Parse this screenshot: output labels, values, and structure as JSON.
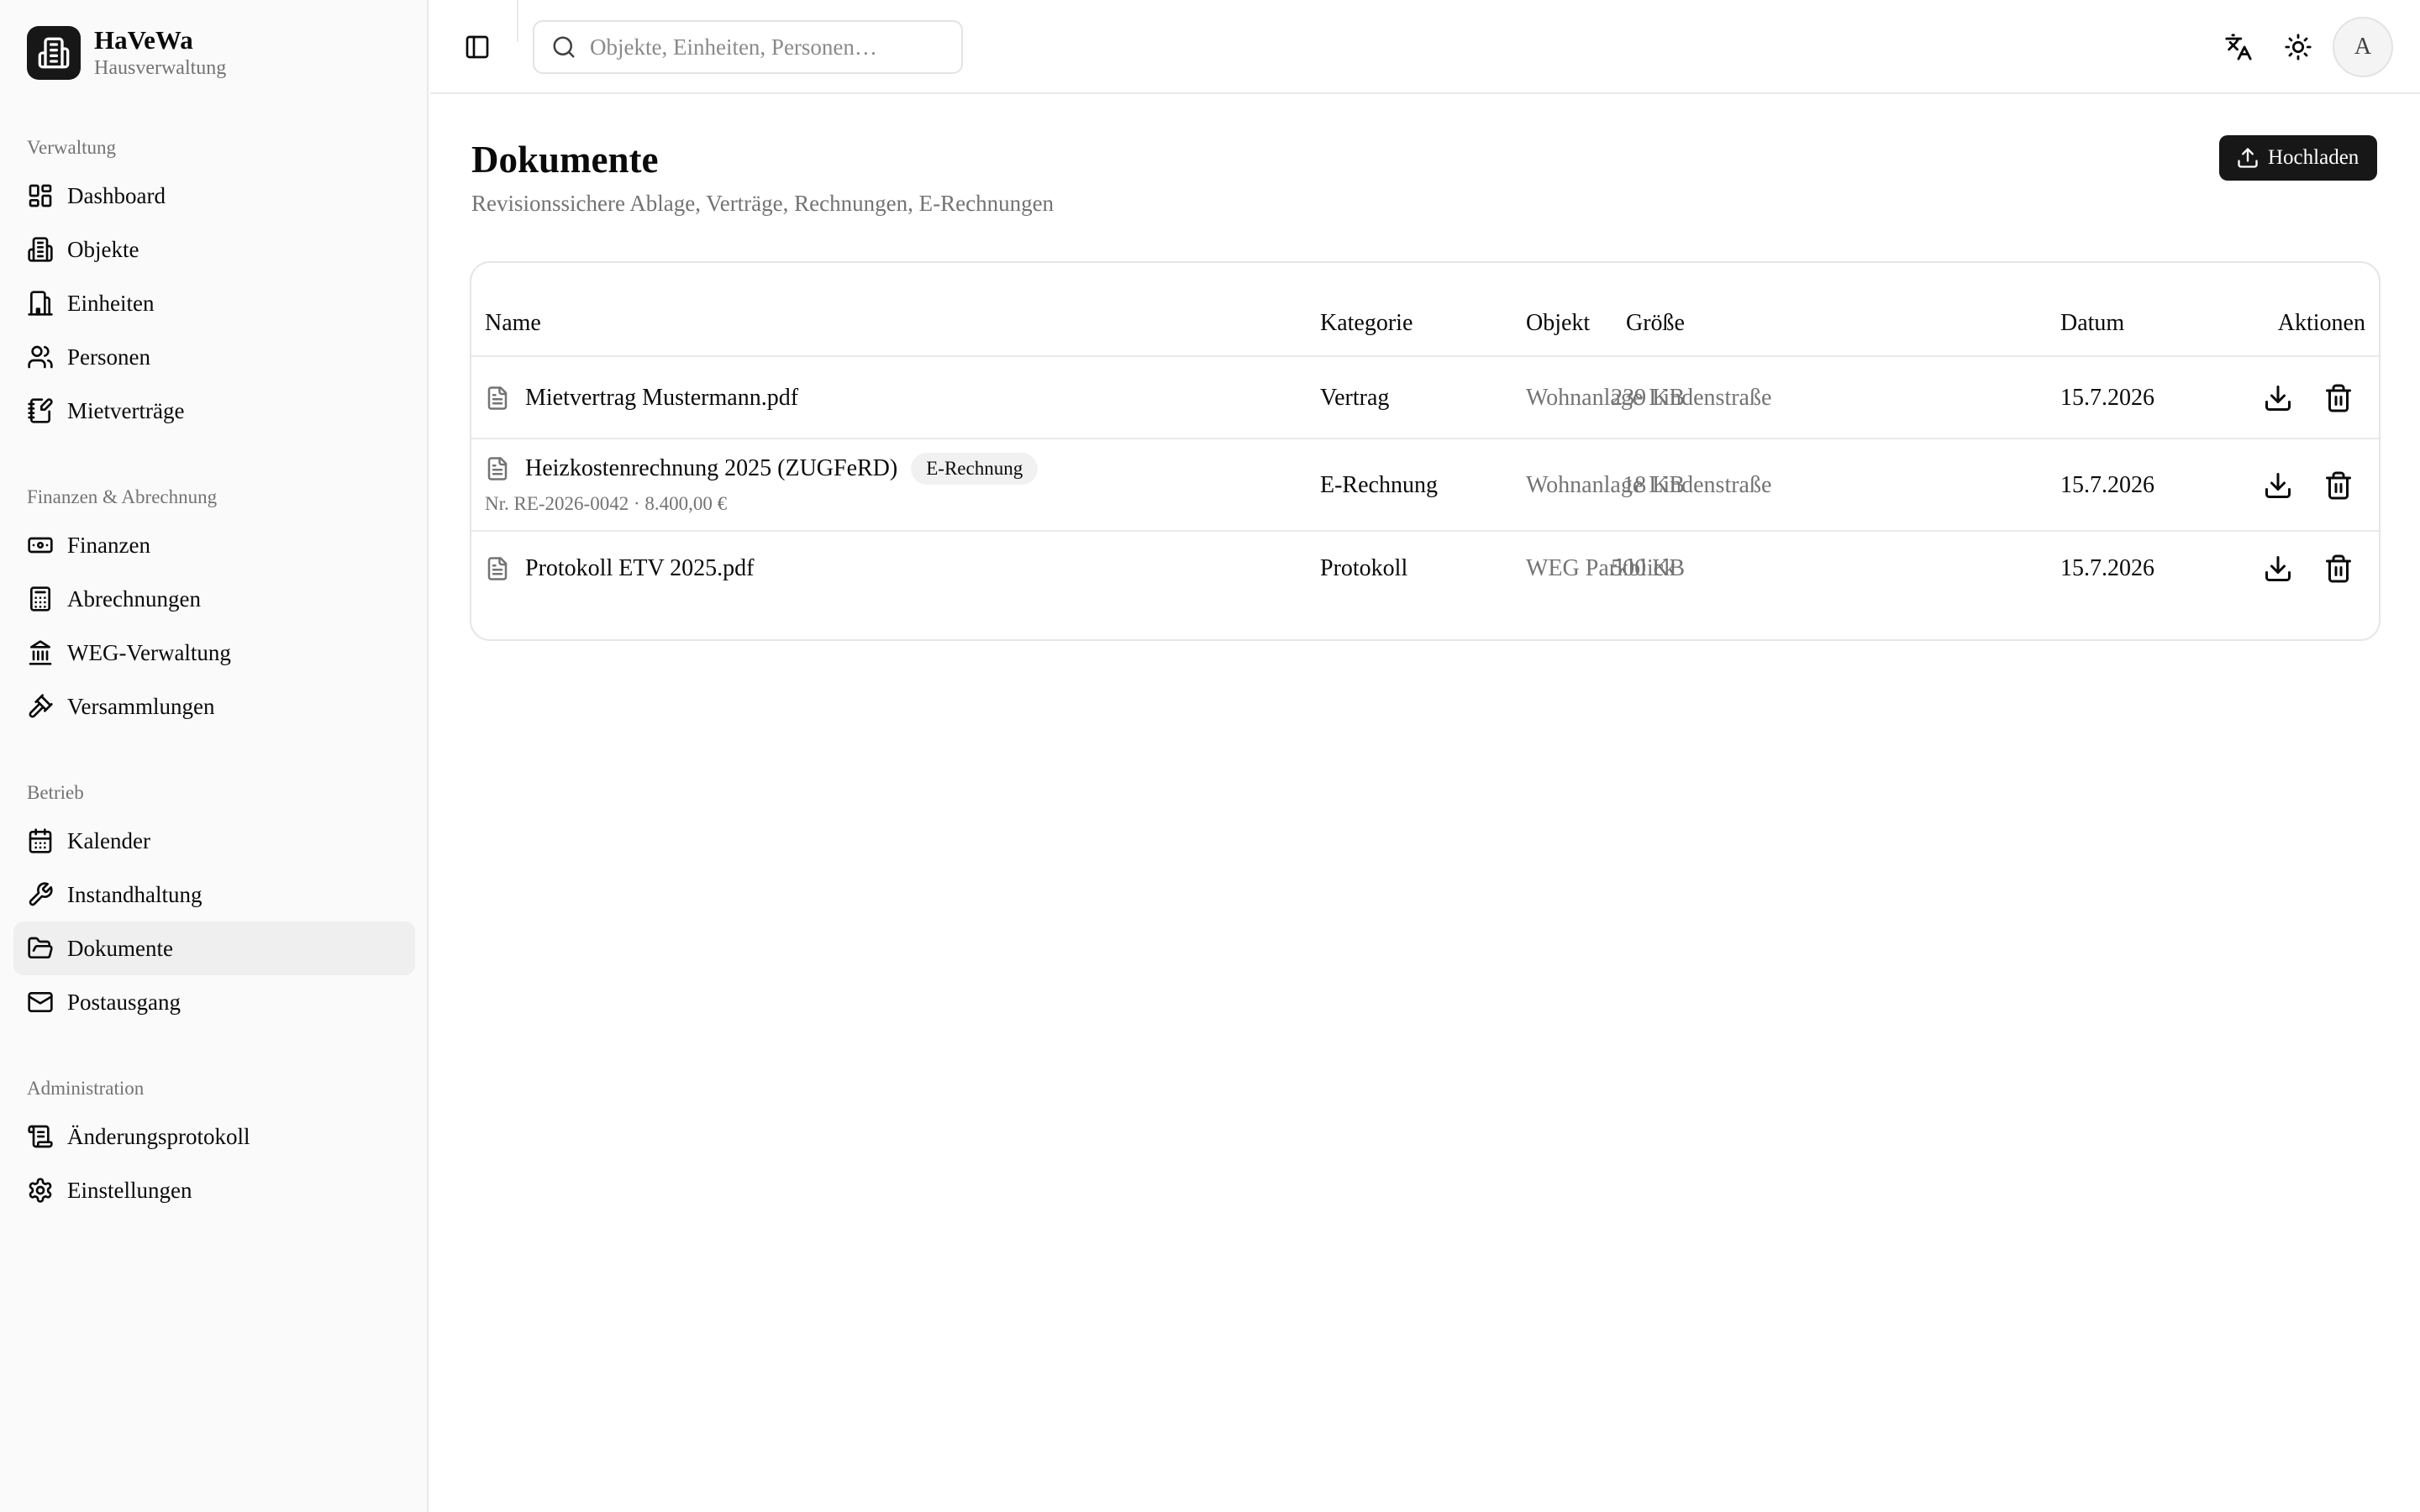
{
  "brand": {
    "name": "HaVeWa",
    "subtitle": "Hausverwaltung"
  },
  "sidebar": {
    "groups": [
      {
        "label": "Verwaltung",
        "items": [
          {
            "label": "Dashboard",
            "icon": "dashboard-icon"
          },
          {
            "label": "Objekte",
            "icon": "building-icon"
          },
          {
            "label": "Einheiten",
            "icon": "unit-icon"
          },
          {
            "label": "Personen",
            "icon": "users-icon"
          },
          {
            "label": "Mietverträge",
            "icon": "contract-icon"
          }
        ]
      },
      {
        "label": "Finanzen & Abrechnung",
        "items": [
          {
            "label": "Finanzen",
            "icon": "banknote-icon"
          },
          {
            "label": "Abrechnungen",
            "icon": "calculator-icon"
          },
          {
            "label": "WEG-Verwaltung",
            "icon": "landmark-icon"
          },
          {
            "label": "Versammlungen",
            "icon": "gavel-icon"
          }
        ]
      },
      {
        "label": "Betrieb",
        "items": [
          {
            "label": "Kalender",
            "icon": "calendar-icon"
          },
          {
            "label": "Instandhaltung",
            "icon": "wrench-icon"
          },
          {
            "label": "Dokumente",
            "icon": "folder-open-icon",
            "active": true
          },
          {
            "label": "Postausgang",
            "icon": "mail-icon"
          }
        ]
      },
      {
        "label": "Administration",
        "items": [
          {
            "label": "Änderungsprotokoll",
            "icon": "scroll-icon"
          },
          {
            "label": "Einstellungen",
            "icon": "gear-icon"
          }
        ]
      }
    ]
  },
  "header": {
    "search_placeholder": "Objekte, Einheiten, Personen…",
    "avatar_initial": "A"
  },
  "page": {
    "title": "Dokumente",
    "subtitle": "Revisionssichere Ablage, Verträge, Rechnungen, E-Rechnungen",
    "upload_label": "Hochladen"
  },
  "table": {
    "columns": {
      "name": "Name",
      "category": "Kategorie",
      "object": "Objekt",
      "size": "Größe",
      "date": "Datum",
      "actions": "Aktionen"
    },
    "rows": [
      {
        "name": "Mietvertrag Mustermann.pdf",
        "category": "Vertrag",
        "object": "Wohnanlage Lindenstraße",
        "size": "239 KB",
        "date": "15.7.2026"
      },
      {
        "name": "Heizkostenrechnung 2025 (ZUGFeRD)",
        "badge": "E-Rechnung",
        "meta": "Nr. RE-2026-0042 · 8.400,00 €",
        "category": "E-Rechnung",
        "object": "Wohnanlage Lindenstraße",
        "size": "18 KB",
        "date": "15.7.2026"
      },
      {
        "name": "Protokoll ETV 2025.pdf",
        "category": "Protokoll",
        "object": "WEG Parkblick",
        "size": "500 KB",
        "date": "15.7.2026"
      }
    ]
  },
  "colors": {
    "primary": "#171717",
    "muted_text": "#737373",
    "border": "#e6e6e6",
    "sidebar_bg": "#fafafa",
    "active_bg": "#efefef"
  }
}
